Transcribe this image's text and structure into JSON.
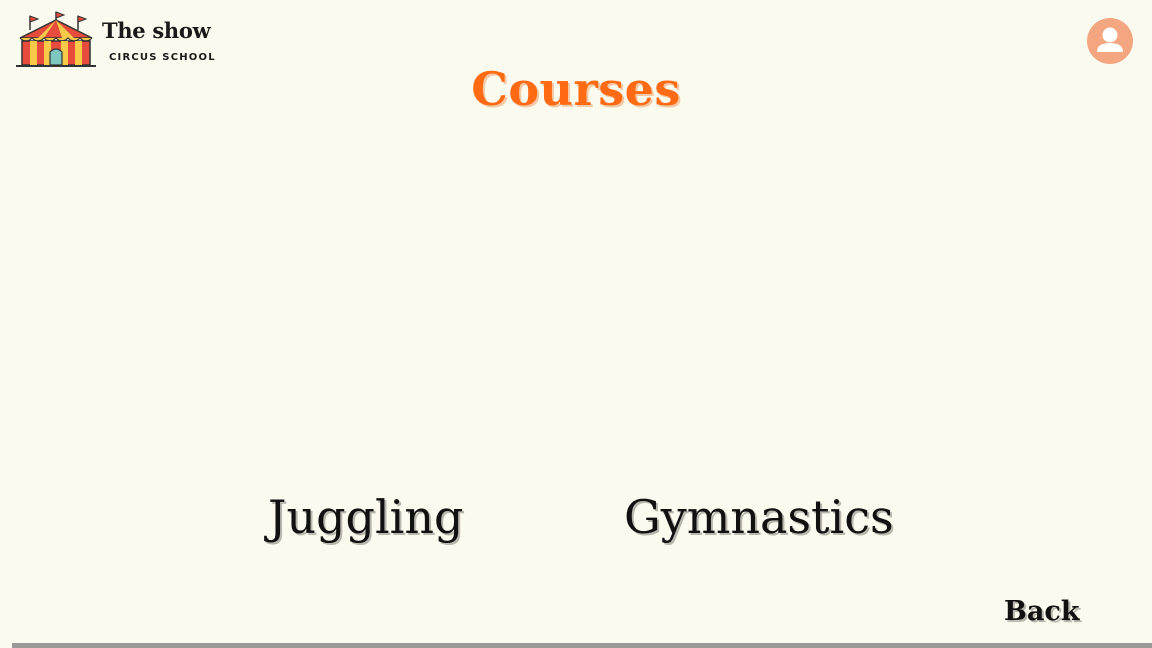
{
  "header": {
    "brand_name": "The show",
    "brand_sub": "CIRCUS SCHOOL",
    "logo_icon": "circus-tent-icon",
    "avatar_icon": "user-icon"
  },
  "main": {
    "title": "Courses",
    "courses": [
      {
        "label": "Juggling"
      },
      {
        "label": "Gymnastics"
      }
    ]
  },
  "footer": {
    "back_label": "Back"
  },
  "colors": {
    "background": "#fbfaee",
    "accent": "#ff6a13",
    "avatar": "#f3a680",
    "text": "#111111"
  }
}
